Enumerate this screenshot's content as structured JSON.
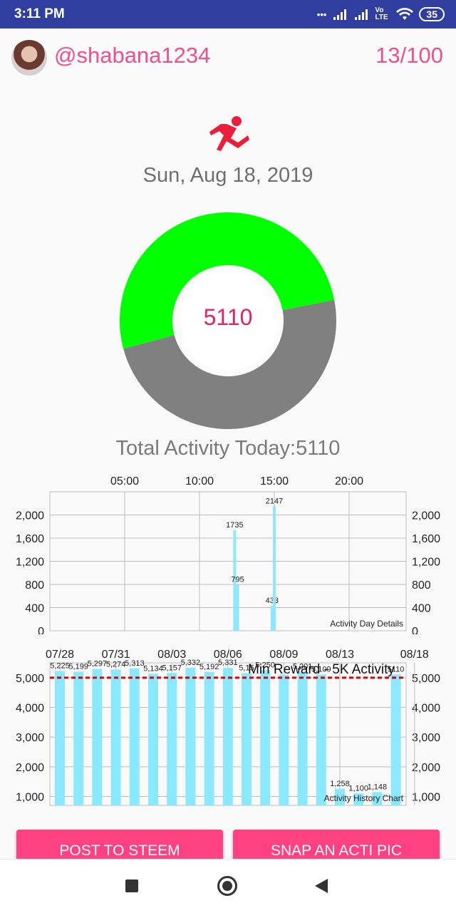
{
  "status": {
    "time": "3:11 PM",
    "dots": "•••",
    "lte": "Vo LTE",
    "battery": "35"
  },
  "header": {
    "username": "@shabana1234",
    "count": "13/100"
  },
  "date": "Sun, Aug 18, 2019",
  "activity": {
    "value": "5110",
    "total_label": "Total Activity Today:5110",
    "fraction": 0.511
  },
  "colors": {
    "accent": "#e91e63",
    "progress": "#00ff00",
    "remaining": "#808080",
    "bar": "#8be9ff",
    "reward_line": "#e00000"
  },
  "chart_data": [
    {
      "type": "bar",
      "title": "Activity Day Details",
      "x_ticks": [
        "05:00",
        "10:00",
        "15:00",
        "20:00"
      ],
      "x_tick_hours": [
        5,
        10,
        15,
        20
      ],
      "y_ticks": [
        "2,000",
        "1,600",
        "1,200",
        "800",
        "400",
        "0"
      ],
      "ylim": [
        0,
        2400
      ],
      "grid": true,
      "points": [
        {
          "hour": 12.35,
          "value": 1735,
          "label": "1735"
        },
        {
          "hour": 12.55,
          "value": 795,
          "label": "795"
        },
        {
          "hour": 14.85,
          "value": 433,
          "label": "433"
        },
        {
          "hour": 15.0,
          "value": 2147,
          "label": "2147"
        }
      ]
    },
    {
      "type": "bar",
      "title": "Activity History Chart",
      "x_ticks": [
        "07/28",
        "07/31",
        "08/03",
        "08/06",
        "08/09",
        "08/13",
        "08/18"
      ],
      "x_tick_index": [
        0,
        3,
        6,
        9,
        12,
        15,
        19
      ],
      "y_ticks": [
        "5,000",
        "4,000",
        "3,000",
        "2,000",
        "1,000"
      ],
      "ylim": [
        700,
        5500
      ],
      "grid": true,
      "reference_line": {
        "value": 5000,
        "label": "Min Reward - 5K Activity"
      },
      "values": [
        5225,
        5199,
        5297,
        5274,
        5313,
        5134,
        5157,
        5332,
        5192,
        5331,
        5150,
        5250,
        5100,
        5201,
        5109,
        1258,
        1100,
        1148,
        5110
      ],
      "labels": [
        "5,225",
        "5,199",
        "5,297",
        "5,274",
        "5,313",
        "5,134",
        "5,157",
        "5,332",
        "5,192",
        "5,331",
        "5,15",
        "5,250",
        "",
        "5,201",
        "5,109",
        "1,258",
        "1,100",
        "1,148",
        "5110"
      ]
    }
  ],
  "buttons": {
    "post": "POST TO STEEM",
    "snap": "SNAP AN ACTI PIC"
  }
}
